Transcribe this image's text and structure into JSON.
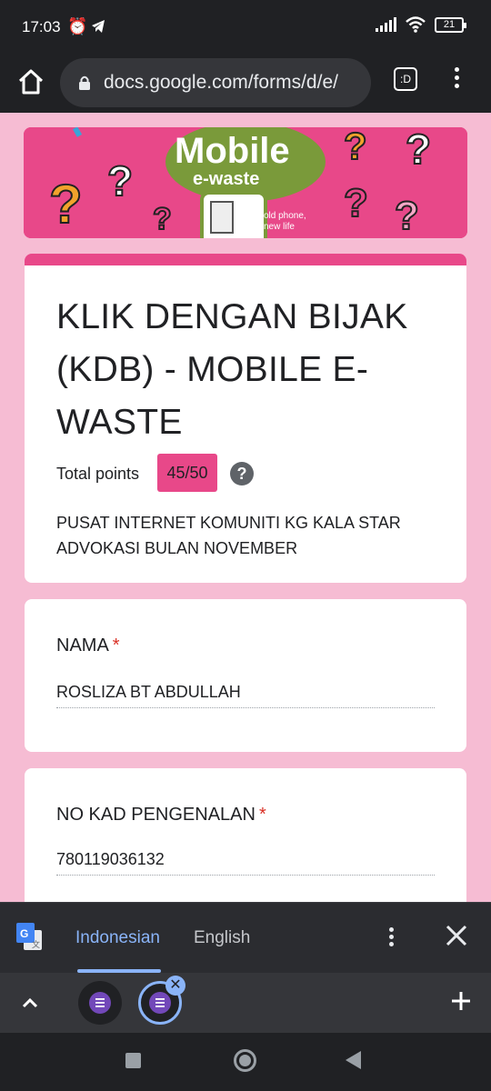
{
  "status_bar": {
    "time": "17:03",
    "battery": "21"
  },
  "browser": {
    "url": "docs.google.com/forms/d/e/",
    "tab_label": ":D"
  },
  "banner": {
    "logo_title": "Mobile",
    "logo_subtitle": "e-waste",
    "slogan_line1": "old phone,",
    "slogan_line2": "new life"
  },
  "form": {
    "title": "KLIK DENGAN BIJAK (KDB) - MOBILE E-WASTE",
    "points_label": "Total points",
    "points_value": "45/50",
    "help_glyph": "?",
    "description": "PUSAT INTERNET KOMUNITI KG KALA STAR ADVOKASI BULAN NOVEMBER",
    "questions": [
      {
        "label": "NAMA",
        "required_mark": "*",
        "answer": "ROSLIZA BT ABDULLAH"
      },
      {
        "label": "NO KAD PENGENALAN",
        "required_mark": "*",
        "answer": "780119036132"
      }
    ]
  },
  "translate_bar": {
    "source_language": "Indonesian",
    "target_language": "English"
  },
  "tab_strip": {
    "close_glyph": "✕"
  },
  "colors": {
    "accent": "#e84889",
    "page_background": "#f6bcd3",
    "browser_chrome": "#202124"
  }
}
